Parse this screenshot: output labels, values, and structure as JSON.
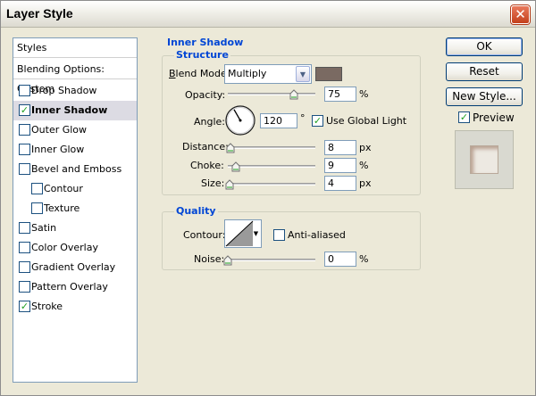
{
  "window": {
    "title": "Layer Style",
    "close_glyph": "✕"
  },
  "styles_list": {
    "header": "Styles",
    "blending": "Blending Options: Custom",
    "items": [
      {
        "label": "Drop Shadow",
        "checked": false
      },
      {
        "label": "Inner Shadow",
        "checked": true,
        "selected": true
      },
      {
        "label": "Outer Glow",
        "checked": false
      },
      {
        "label": "Inner Glow",
        "checked": false
      },
      {
        "label": "Bevel and Emboss",
        "checked": false
      },
      {
        "label": "Contour",
        "checked": false,
        "sub": true
      },
      {
        "label": "Texture",
        "checked": false,
        "sub": true
      },
      {
        "label": "Satin",
        "checked": false
      },
      {
        "label": "Color Overlay",
        "checked": false
      },
      {
        "label": "Gradient Overlay",
        "checked": false
      },
      {
        "label": "Pattern Overlay",
        "checked": false
      },
      {
        "label": "Stroke",
        "checked": true
      }
    ]
  },
  "inner_shadow": {
    "section_title": "Inner Shadow",
    "structure": {
      "title": "Structure",
      "blend_mode_label": "Blend Mode:",
      "blend_mode_value": "Multiply",
      "shadow_color": "#7a6a62",
      "opacity_label": "Opacity:",
      "opacity_value": "75",
      "opacity_unit": "%",
      "opacity_fraction": 0.75,
      "angle_label": "Angle:",
      "angle_value": "120",
      "angle_unit": "°",
      "use_global_light_label": "Use Global Light",
      "use_global_light_checked": true,
      "distance_label": "Distance:",
      "distance_value": "8",
      "distance_unit": "px",
      "distance_fraction": 0.03,
      "choke_label": "Choke:",
      "choke_value": "9",
      "choke_unit": "%",
      "choke_fraction": 0.09,
      "size_label": "Size:",
      "size_value": "4",
      "size_unit": "px",
      "size_fraction": 0.016
    },
    "quality": {
      "title": "Quality",
      "contour_label": "Contour:",
      "anti_aliased_label": "Anti-aliased",
      "anti_aliased_checked": false,
      "noise_label": "Noise:",
      "noise_value": "0",
      "noise_unit": "%",
      "noise_fraction": 0.0
    }
  },
  "buttons": {
    "ok": "OK",
    "reset": "Reset",
    "new_style": "New Style...",
    "preview_label": "Preview",
    "preview_checked": true
  },
  "colors": {
    "accent_blue": "#0046d5",
    "selected_row": "#dcdbe3",
    "check_green": "#21a121"
  }
}
